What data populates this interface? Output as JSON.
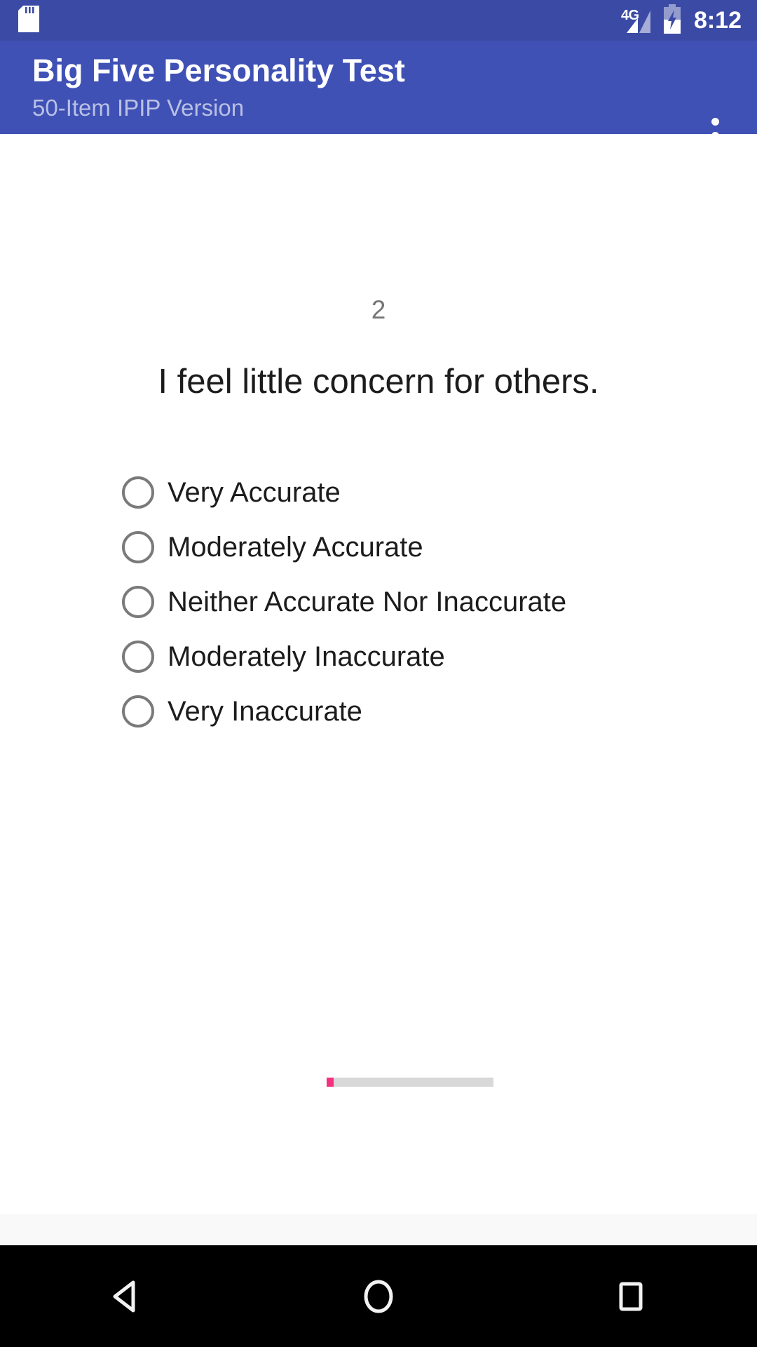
{
  "status_bar": {
    "sdcard_icon": "sdcard-icon",
    "network_label": "4G",
    "signal_icon": "signal-bars-icon",
    "battery_icon": "battery-charging-icon",
    "time": "8:12",
    "background_color": "#3b4ba5"
  },
  "app_bar": {
    "title": "Big Five Personality Test",
    "subtitle": "50-Item IPIP Version",
    "overflow_icon": "overflow-menu-icon",
    "background_color": "#3f51b5",
    "title_color": "#ffffff",
    "subtitle_color": "#b9c0e4"
  },
  "question": {
    "number": "2",
    "text": "I feel little concern for others.",
    "number_color": "#757575",
    "text_color": "#1c1c1c"
  },
  "options": [
    {
      "label": "Very Accurate",
      "selected": false
    },
    {
      "label": "Moderately Accurate",
      "selected": false
    },
    {
      "label": "Neither Accurate Nor Inaccurate",
      "selected": false
    },
    {
      "label": "Moderately Inaccurate",
      "selected": false
    },
    {
      "label": "Very Inaccurate",
      "selected": false
    }
  ],
  "progress": {
    "percent": 4,
    "fill_color": "#f5317f",
    "track_color": "#d8d8d8"
  },
  "nav_bar": {
    "back_icon": "back-triangle-icon",
    "home_icon": "home-circle-icon",
    "recents_icon": "recents-square-icon",
    "background_color": "#000000"
  }
}
